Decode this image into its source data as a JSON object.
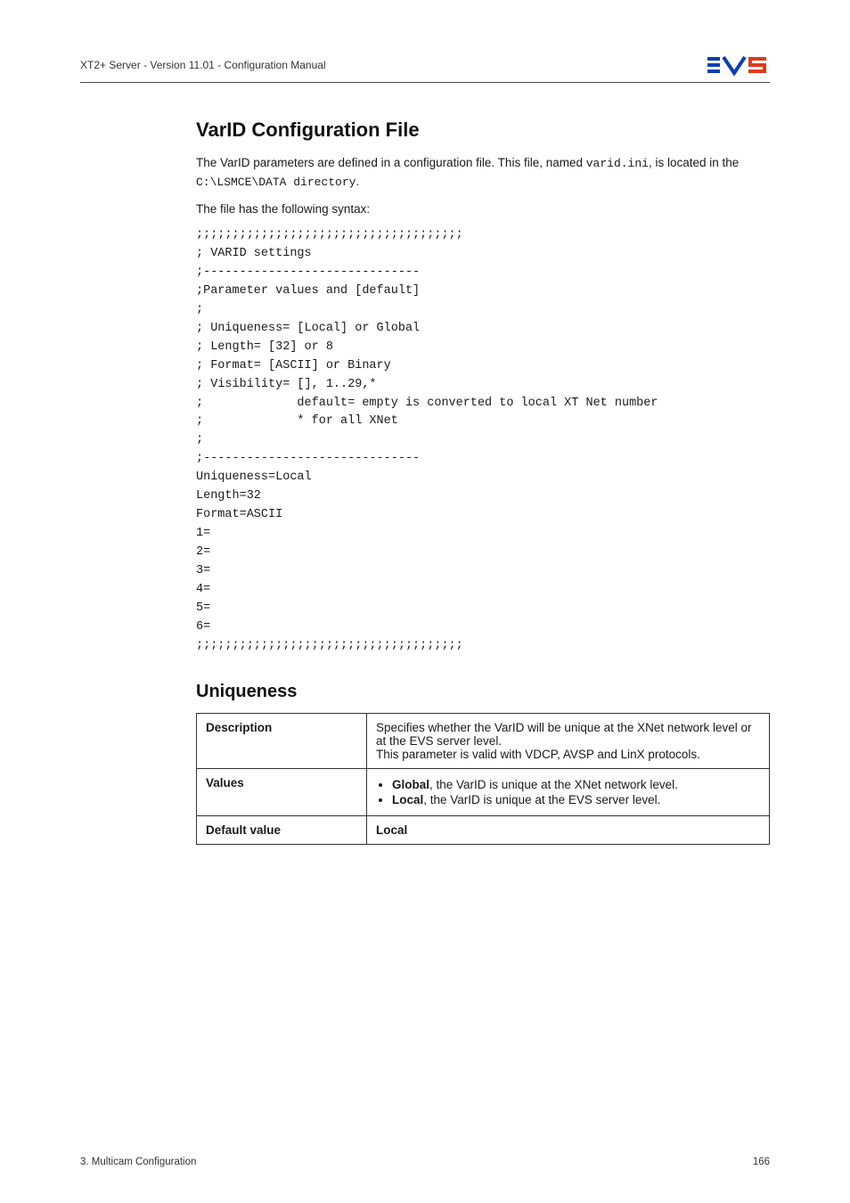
{
  "header": {
    "doc_title": "XT2+ Server - Version 11.01 - Configuration Manual"
  },
  "section1": {
    "title": "VarID Configuration File",
    "intro_pre": "The VarID parameters are defined in a configuration file. This file, named ",
    "intro_code1": "varid.ini",
    "intro_mid": ", is located in the ",
    "intro_code2": "C:\\LSMCE\\DATA directory",
    "intro_post": ".",
    "syntax_intro": "The file has the following syntax:",
    "code": ";;;;;;;;;;;;;;;;;;;;;;;;;;;;;;;;;;;;;\n; VARID settings\n;------------------------------\n;Parameter values and [default]\n;\n; Uniqueness= [Local] or Global\n; Length= [32] or 8\n; Format= [ASCII] or Binary\n; Visibility= [], 1..29,*\n;             default= empty is converted to local XT Net number\n;             * for all XNet\n;\n;------------------------------\nUniqueness=Local\nLength=32\nFormat=ASCII\n1=\n2=\n3=\n4=\n5=\n6=\n;;;;;;;;;;;;;;;;;;;;;;;;;;;;;;;;;;;;;"
  },
  "section2": {
    "title": "Uniqueness",
    "rows": {
      "desc_label": "Description",
      "desc_text": "Specifies whether the VarID will be unique at the XNet network level or at the EVS server level.\nThis parameter is valid with VDCP, AVSP and LinX protocols.",
      "values_label": "Values",
      "value_global_strong": "Global",
      "value_global_rest": ", the VarID is unique at the XNet network level.",
      "value_local_strong": "Local",
      "value_local_rest": ", the VarID is unique at the EVS server level.",
      "default_label": "Default value",
      "default_value": "Local"
    }
  },
  "footer": {
    "left": "3. Multicam Configuration",
    "right": "166"
  }
}
